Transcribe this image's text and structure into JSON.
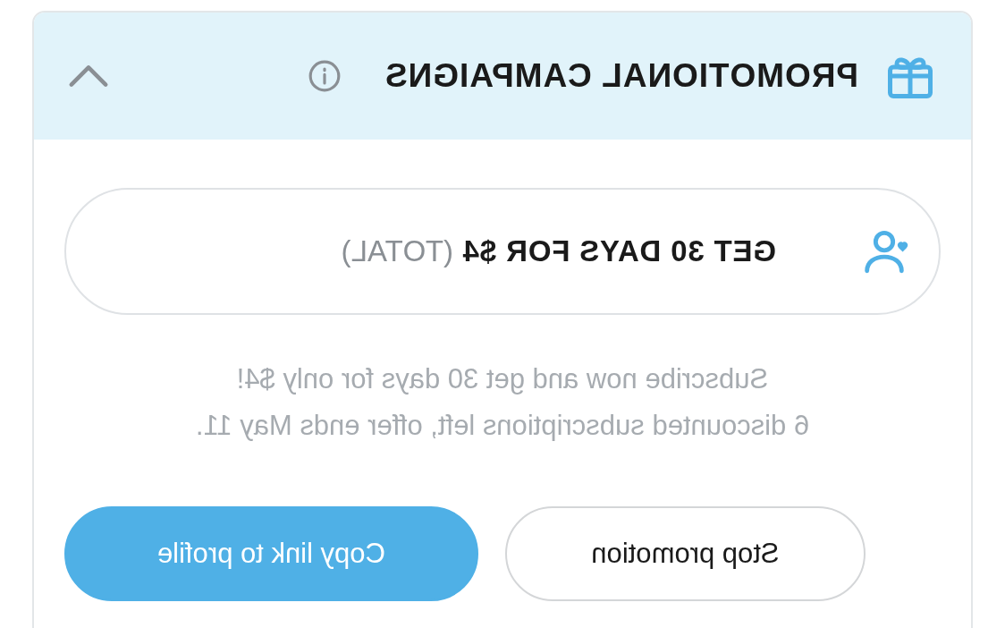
{
  "panel": {
    "title": "PROMOTIONAL CAMPAIGNS",
    "expanded": true
  },
  "offer": {
    "note": "(TOTAL)",
    "headline": "GET 30 DAYS FOR $4"
  },
  "description": [
    "Subscribe now and get 30 days for only $4!",
    "6 discounted subscriptions left, offer ends May 11."
  ],
  "buttons": [
    {
      "label": "Copy link to profile",
      "kind": "primary"
    },
    {
      "label": "Stop promotion",
      "kind": "outline"
    }
  ]
}
